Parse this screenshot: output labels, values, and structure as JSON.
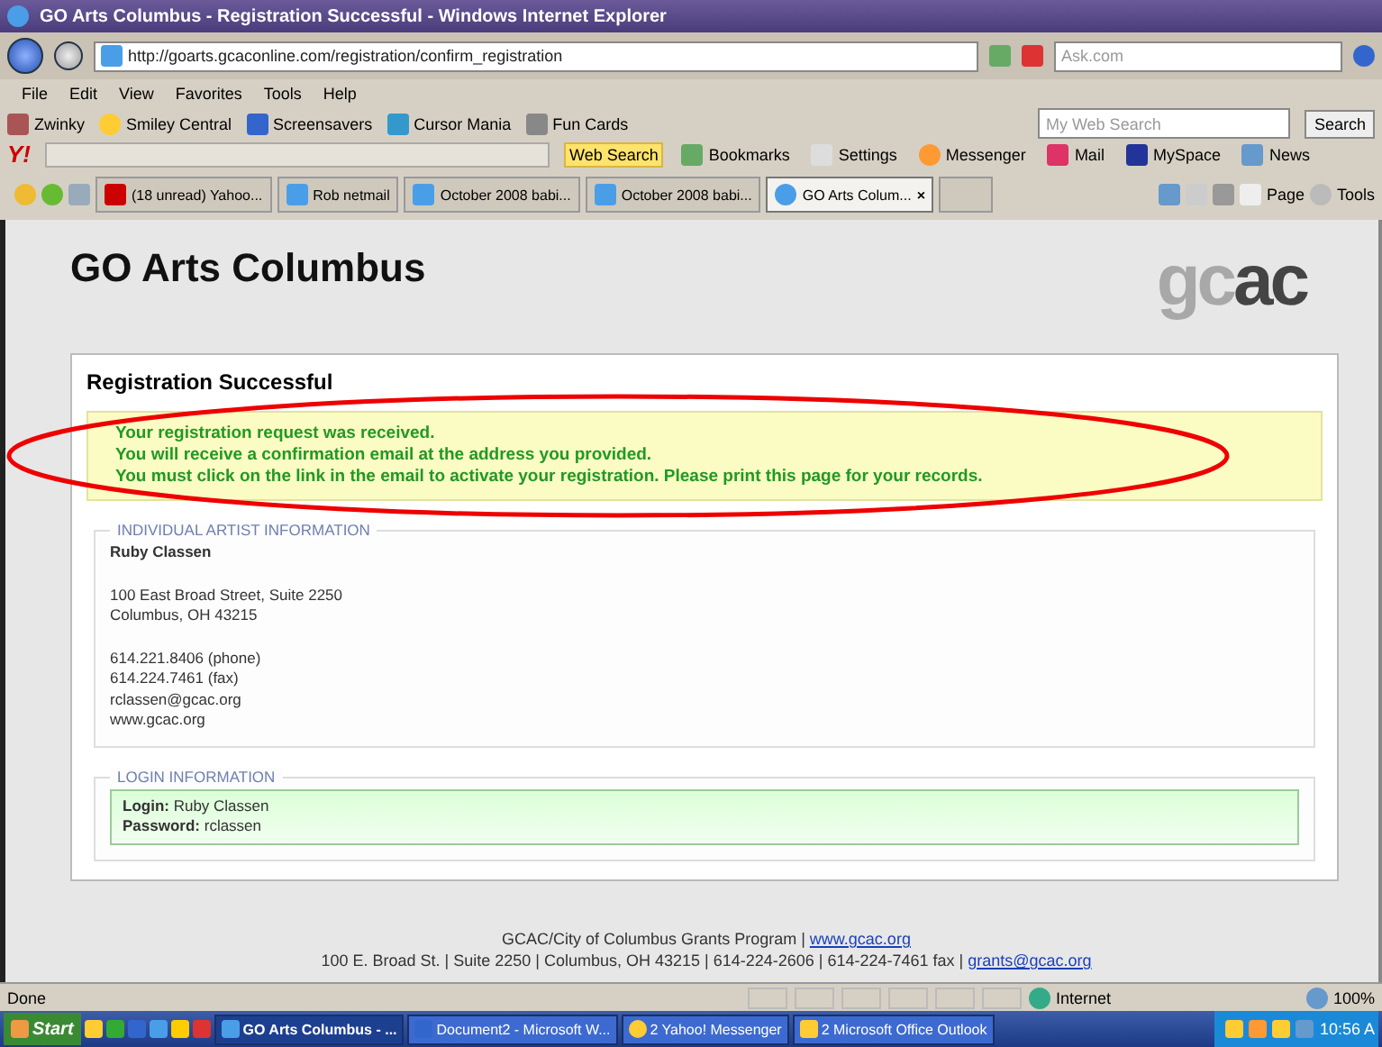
{
  "window": {
    "title": "GO Arts Columbus - Registration Successful - Windows Internet Explorer"
  },
  "address_bar": {
    "url": "http://goarts.gcaconline.com/registration/confirm_registration",
    "search_placeholder": "Ask.com"
  },
  "menu": [
    "File",
    "Edit",
    "View",
    "Favorites",
    "Tools",
    "Help"
  ],
  "links_bar": {
    "items": [
      "Zwinky",
      "Smiley Central",
      "Screensavers",
      "Cursor Mania",
      "Fun Cards"
    ],
    "search_placeholder": "My Web Search",
    "search_button": "Search"
  },
  "yahoo_toolbar": {
    "logo": "Y!",
    "items": [
      {
        "label": "Web Search",
        "selected": true
      },
      {
        "label": "Bookmarks",
        "selected": false
      },
      {
        "label": "Settings",
        "selected": false
      },
      {
        "label": "Messenger",
        "selected": false
      },
      {
        "label": "Mail",
        "selected": false
      },
      {
        "label": "MySpace",
        "selected": false
      },
      {
        "label": "News",
        "selected": false
      }
    ]
  },
  "tabs": [
    {
      "label": "(18 unread) Yahoo...",
      "selected": false
    },
    {
      "label": "Rob netmail",
      "selected": false
    },
    {
      "label": "October 2008 babi...",
      "selected": false
    },
    {
      "label": "October 2008 babi...",
      "selected": false
    },
    {
      "label": "GO Arts Colum...",
      "selected": true
    }
  ],
  "tab_close": "×",
  "command_bar": [
    "Page",
    "Tools"
  ],
  "page": {
    "heading": "GO Arts Columbus",
    "logo": [
      "gc",
      "ac"
    ],
    "card_title": "Registration Successful",
    "messages": [
      "Your registration request was received.",
      "You will receive a confirmation email at the address you provided.",
      "You must click on the link in the email to activate your registration. Please print this page for your records."
    ],
    "artist": {
      "legend": "INDIVIDUAL ARTIST INFORMATION",
      "name": "Ruby Classen",
      "groups": [
        [
          "100 East Broad Street, Suite 2250",
          "Columbus, OH 43215"
        ],
        [
          "614.221.8406 (phone)",
          "614.224.7461 (fax)",
          "rclassen@gcac.org",
          "www.gcac.org"
        ]
      ]
    },
    "login": {
      "legend": "LOGIN INFORMATION",
      "fields": [
        {
          "label": "Login:",
          "value": "Ruby Classen"
        },
        {
          "label": "Password:",
          "value": "rclassen"
        }
      ]
    },
    "footer": [
      {
        "text": "GCAC/City of Columbus Grants Program |",
        "link": "www.gcac.org"
      },
      {
        "text": "100 E. Broad St. | Suite 2250 | Columbus, OH 43215 | 614-224-2606 | 614-224-7461 fax |",
        "link": "grants@gcac.org"
      }
    ]
  },
  "annotation": {
    "kind": "ellipse"
  },
  "status_bar": {
    "text": "Done",
    "zone": "Internet",
    "zoom": "100%"
  },
  "taskbar": {
    "start": "Start",
    "items": [
      {
        "label": "GO Arts Columbus - ...",
        "selected": true
      },
      {
        "label": "Document2 - Microsoft W...",
        "selected": false
      },
      {
        "label": "2 Yahoo! Messenger",
        "selected": false
      },
      {
        "label": "2 Microsoft Office Outlook",
        "selected": false
      }
    ],
    "clock": "10:56 A"
  }
}
